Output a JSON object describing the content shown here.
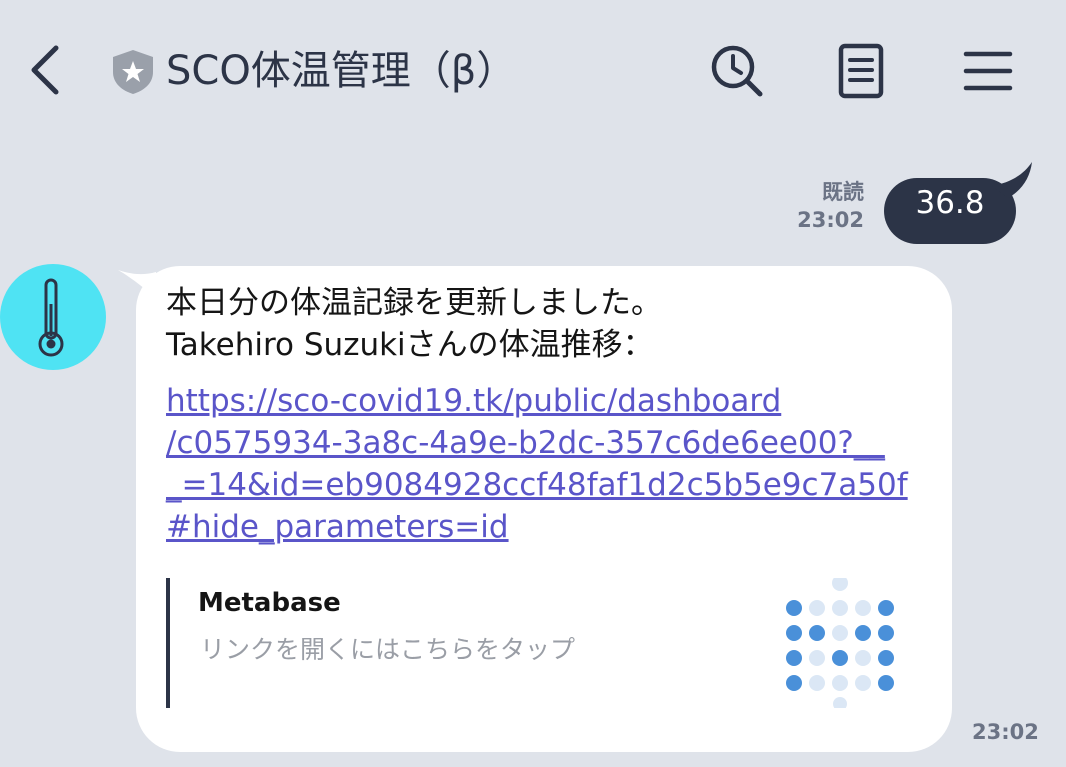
{
  "header": {
    "title": "SCO体温管理（β）",
    "back_icon": "chevron-left-icon",
    "official_badge_icon": "shield-star-icon",
    "search_icon": "search-clock-icon",
    "notes_icon": "note-icon",
    "menu_icon": "hamburger-menu-icon"
  },
  "outgoing": {
    "read_label": "既読",
    "time": "23:02",
    "text": "36.8",
    "bubble_color": "#2c3447"
  },
  "incoming": {
    "avatar_icon": "thermometer-icon",
    "avatar_color": "#4fe3f3",
    "lines": [
      "本日分の体温記録を更新しました。",
      "Takehiro Suzukiさんの体温推移："
    ],
    "link_lines": [
      "https://sco-covid19.tk/public/dashboard",
      "/c0575934-3a8c-4a9e-b2dc-357c6de6ee00?__",
      "_=14&id=eb9084928ccf48faf1d2c5b5e9c7a50f",
      "#hide_parameters=id"
    ],
    "link_color": "#5a55c9",
    "preview": {
      "title": "Metabase",
      "subtitle": "リンクを開くにはこちらをタップ",
      "thumb_icon": "metabase-logo-icon"
    },
    "time": "23:02"
  }
}
